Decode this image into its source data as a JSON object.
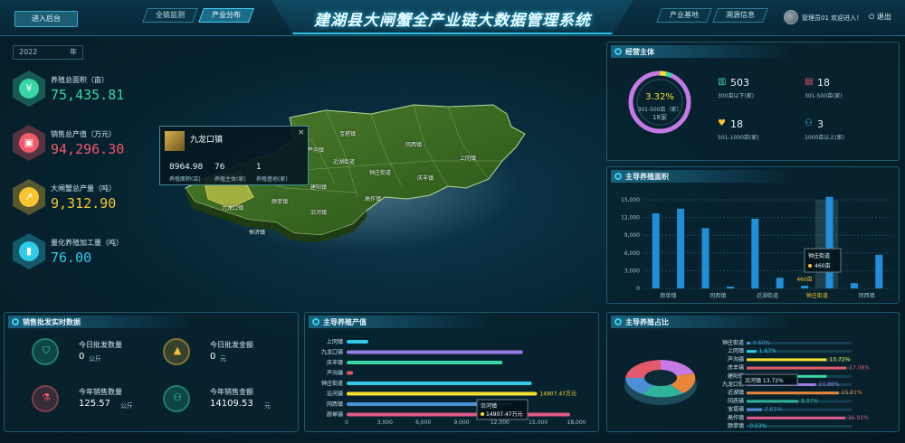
{
  "header": {
    "enter_button": "进入后台",
    "title": "建湖县大闸蟹全产业链大数据管理系统",
    "tabs_left": [
      "全链监测",
      "产业分布"
    ],
    "tabs_right": [
      "产业基地",
      "溯源信息"
    ],
    "user_text": "管理员01 欢迎进入！",
    "logout": "退出"
  },
  "year": {
    "value": "2022",
    "unit": "年"
  },
  "left_stats": [
    {
      "label": "养殖总面积（亩）",
      "value": "75,435.81",
      "color": "#39d6a6",
      "icon": "yuan-icon"
    },
    {
      "label": "销售总产值（万元）",
      "value": "94,296.30",
      "color": "#f05a6a",
      "icon": "bag-icon"
    },
    {
      "label": "大闸蟹总产量（吨）",
      "value": "9,312.90",
      "color": "#f5c532",
      "icon": "chart-line-icon"
    },
    {
      "label": "量化养殖加工量（吨）",
      "value": "76.00",
      "color": "#2fcbe8",
      "icon": "bar-chart-icon"
    }
  ],
  "map": {
    "labels": [
      {
        "text": "宝塔镇",
        "x": 375,
        "y": 143
      },
      {
        "text": "冈西镇",
        "x": 448,
        "y": 155
      },
      {
        "text": "近湖街道",
        "x": 368,
        "y": 174
      },
      {
        "text": "钟庄街道",
        "x": 408,
        "y": 186
      },
      {
        "text": "庆丰镇",
        "x": 461,
        "y": 192
      },
      {
        "text": "上冈镇",
        "x": 508,
        "y": 170
      },
      {
        "text": "芦沟镇",
        "x": 340,
        "y": 161
      },
      {
        "text": "建阳镇",
        "x": 343,
        "y": 202
      },
      {
        "text": "高作镇",
        "x": 403,
        "y": 215
      },
      {
        "text": "颜单镇",
        "x": 300,
        "y": 218
      },
      {
        "text": "沿河镇",
        "x": 343,
        "y": 230
      },
      {
        "text": "九龙口镇",
        "x": 245,
        "y": 225
      },
      {
        "text": "恒济镇",
        "x": 275,
        "y": 252
      }
    ],
    "popup": {
      "name": "九龙口镇",
      "area": "8964.98",
      "area_label": "养殖面积(亩)",
      "enterprises": "76",
      "enterprises_label": "养殖主体(家)",
      "bases": "1",
      "bases_label": "养殖基地(家)",
      "close": "×"
    }
  },
  "operators": {
    "title": "经营主体",
    "ring_percent": "3.32%",
    "ring_label": "301-500亩（家）",
    "ring_value": "18家",
    "items": [
      {
        "value": "503",
        "label": "300亩以下(家)",
        "color": "#39d6a6",
        "icon": "building-icon"
      },
      {
        "value": "18",
        "label": "301-500亩(家)",
        "color": "#f05a6a",
        "icon": "document-icon"
      },
      {
        "value": "18",
        "label": "501-1000亩(家)",
        "color": "#f5c532",
        "icon": "heart-icon"
      },
      {
        "value": "3",
        "label": "1000亩以上(家)",
        "color": "#2fcbe8",
        "icon": "people-icon"
      }
    ]
  },
  "breeding_area": {
    "title": "主导养殖面积",
    "chart_data": {
      "type": "bar",
      "categories": [
        "颜单镇",
        "",
        "冈西镇",
        "",
        "近湖街道",
        "",
        "钟庄街道",
        "",
        "冈西镇",
        ""
      ],
      "values": [
        12700,
        13500,
        10200,
        300,
        11800,
        1800,
        460,
        15500,
        900,
        5700
      ],
      "ylim": [
        0,
        15000
      ],
      "yticks": [
        "15,000",
        "12,000",
        "9,000",
        "6,000",
        "3,000",
        "0"
      ],
      "tick_labels": [
        "颜单镇",
        "冈西镇",
        "近湖街道",
        "钟庄街道",
        "冈西镇"
      ],
      "tooltip_name": "钟庄街道",
      "tooltip_value": "460亩",
      "bar_label": "460亩"
    }
  },
  "sales": {
    "title": "销售批发实时数据",
    "items": [
      {
        "label": "今日批发数量",
        "value": "0",
        "unit": "公斤",
        "color": "#39d6a6",
        "icon": "shield-icon"
      },
      {
        "label": "今日批发金额",
        "value": "0",
        "unit": "元",
        "color": "#f5c532",
        "icon": "mountain-icon"
      },
      {
        "label": "今年销售数量",
        "value": "125.57",
        "unit": "公斤",
        "color": "#f05a6a",
        "icon": "flask-icon"
      },
      {
        "label": "今年销售金额",
        "value": "14109.53",
        "unit": "元",
        "color": "#39d6a6",
        "icon": "group-icon"
      }
    ]
  },
  "output_value": {
    "title": "主导养殖产值",
    "chart_data": {
      "type": "bar",
      "categories": [
        "上冈镇",
        "九龙口镇",
        "庆丰镇",
        "芦沟镇",
        "钟庄街道",
        "沿河镇",
        "冈西镇",
        "颜单镇"
      ],
      "values": [
        1700,
        13800,
        12200,
        500,
        14500,
        14907.47,
        13000,
        17500
      ],
      "xlim": [
        0,
        18000
      ],
      "xticks": [
        "0",
        "3,000",
        "6,000",
        "9,000",
        "12,000",
        "15,000",
        "18,000"
      ],
      "value_label": "14907.47万元",
      "tooltip_name": "沿河镇",
      "tooltip_value": "14907.47万元"
    }
  },
  "share": {
    "title": "主导养殖占比",
    "chart_data": {
      "type": "bar",
      "categories": [
        "钟庄街道",
        "上冈镇",
        "芦沟镇",
        "庆丰镇",
        "建阳镇",
        "九龙口镇",
        "近湖镇",
        "冈西镇",
        "宝塔镇",
        "高作镇",
        "颜单镇"
      ],
      "values": [
        0.6,
        1.67,
        13.72,
        17.08,
        13.72,
        11.88,
        15.81,
        8.87,
        2.61,
        16.91,
        0.03
      ],
      "labels": [
        "0.60%",
        "1.67%",
        "13.72%",
        "17.08%",
        "",
        "11.88%",
        "15.81%",
        "8.87%",
        "2.61%",
        "16.91%",
        "0.03%"
      ],
      "tooltip": "沿河镇 13.72%"
    }
  }
}
